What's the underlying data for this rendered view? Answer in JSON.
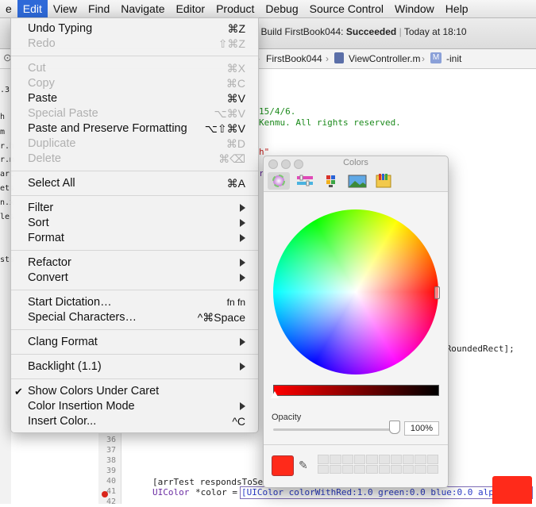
{
  "menubar": {
    "items": [
      "e",
      "Edit",
      "View",
      "Find",
      "Navigate",
      "Editor",
      "Product",
      "Debug",
      "Source Control",
      "Window",
      "Help"
    ],
    "active": "Edit"
  },
  "toolbar": {
    "build_label": "Build FirstBook044:",
    "build_result": "Succeeded",
    "timestamp": "Today at 18:10"
  },
  "jumpbar": {
    "project": "FirstBook044",
    "file": "ViewController.m",
    "badge": "M",
    "symbol": "-init"
  },
  "edit_menu": {
    "items": [
      {
        "label": "Undo Typing",
        "shortcut": "⌘Z",
        "enabled": true
      },
      {
        "label": "Redo",
        "shortcut": "⇧⌘Z",
        "enabled": false
      },
      {
        "label": "Cut",
        "shortcut": "⌘X",
        "enabled": false
      },
      {
        "label": "Copy",
        "shortcut": "⌘C",
        "enabled": false
      },
      {
        "label": "Paste",
        "shortcut": "⌘V",
        "enabled": true
      },
      {
        "label": "Special Paste",
        "shortcut": "⌥⌘V",
        "enabled": false
      },
      {
        "label": "Paste and Preserve Formatting",
        "shortcut": "⌥⇧⌘V",
        "enabled": true
      },
      {
        "label": "Duplicate",
        "shortcut": "⌘D",
        "enabled": false
      },
      {
        "label": "Delete",
        "shortcut": "⌘⌫",
        "enabled": false
      },
      {
        "label": "Select All",
        "shortcut": "⌘A",
        "enabled": true
      },
      {
        "label": "Filter",
        "submenu": true
      },
      {
        "label": "Sort",
        "submenu": true
      },
      {
        "label": "Format",
        "submenu": true
      },
      {
        "label": "Refactor",
        "submenu": true
      },
      {
        "label": "Convert",
        "submenu": true
      },
      {
        "label": "Start Dictation…",
        "shortcut": "fn fn",
        "enabled": true
      },
      {
        "label": "Special Characters…",
        "shortcut": "^⌘Space",
        "enabled": true
      },
      {
        "label": "Clang Format",
        "submenu": true
      },
      {
        "label": "Backlight (1.1)",
        "submenu": true
      },
      {
        "label": "Show Colors Under Caret",
        "checked": true
      },
      {
        "label": "Color Insertion Mode",
        "submenu": true
      },
      {
        "label": "Insert Color...",
        "shortcut": "^C",
        "enabled": true
      }
    ]
  },
  "colors_panel": {
    "title": "Colors",
    "tabs": [
      "color-wheel",
      "color-sliders",
      "color-palettes",
      "image-palettes",
      "crayons"
    ],
    "selected_tab": "color-wheel",
    "opacity_label": "Opacity",
    "opacity_value": "100%",
    "opacity_level": 1.0,
    "current_color": "#ff2a1a",
    "brightness_level": 0.03
  },
  "editor": {
    "fragments": {
      "date_frag": "15/4/6.",
      "rights_frag": "Kenmu. All rights reserved.",
      "h_frag": "h\"",
      "r_frag": "r",
      "rounded_frag": "eRoundedRect];",
      "responds_line": "[arrTest respondsToSe",
      "uicolor_kw": "UIColor",
      "color_var": "*color =",
      "color_expr": "[UIColor colorWithRed:1.0 green:0.0 blue:0.0 alpha:1.0]"
    },
    "line_numbers": [
      "36",
      "37",
      "38",
      "39",
      "40",
      "41",
      "42"
    ],
    "sidebar_fragments": [
      ".3",
      "h",
      "m",
      "r.h",
      "r.m",
      "arc",
      "ets",
      "n.x",
      "les",
      "sts"
    ]
  }
}
